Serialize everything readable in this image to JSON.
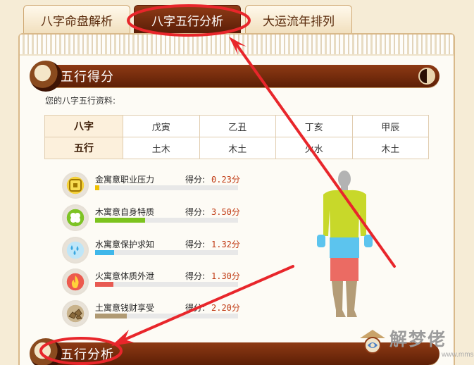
{
  "tabs": [
    {
      "label": "八字命盘解析",
      "active": false
    },
    {
      "label": "八字五行分析",
      "active": true
    },
    {
      "label": "大运流年排列",
      "active": false
    }
  ],
  "sections": {
    "scores_title": "五行得分",
    "analysis_title": "五行分析"
  },
  "intro": "您的八字五行资料:",
  "table": {
    "rows": [
      {
        "head": "八字",
        "cells": [
          "戊寅",
          "乙丑",
          "丁亥",
          "甲辰"
        ]
      },
      {
        "head": "五行",
        "cells": [
          "土木",
          "木土",
          "火水",
          "木土"
        ]
      }
    ]
  },
  "scores": [
    {
      "element": "metal",
      "icon": "coin-icon",
      "label": "金寓意职业压力",
      "score_label": "得分:",
      "score": "0.23分",
      "value": 0.23,
      "color": "#f0c000"
    },
    {
      "element": "wood",
      "icon": "clover-icon",
      "label": "木寓意自身特质",
      "score_label": "得分:",
      "score": "3.50分",
      "value": 3.5,
      "color": "#7cc31e"
    },
    {
      "element": "water",
      "icon": "water-drops-icon",
      "label": "水寓意保护求知",
      "score_label": "得分:",
      "score": "1.32分",
      "value": 1.32,
      "color": "#3fb7ea"
    },
    {
      "element": "fire",
      "icon": "flame-icon",
      "label": "火寓意体质外泄",
      "score_label": "得分:",
      "score": "1.30分",
      "value": 1.3,
      "color": "#e85a52"
    },
    {
      "element": "earth",
      "icon": "rocks-icon",
      "label": "土寓意钱财享受",
      "score_label": "得分:",
      "score": "2.20分",
      "value": 2.2,
      "color": "#b09a73"
    }
  ],
  "score_max": 10,
  "figure_colors": {
    "head": "#b3b3b3",
    "torso": "#c8d82a",
    "hands": "#5cc4ee",
    "shorts": "#5cc4ee",
    "thighs": "#eb6b63",
    "legs": "#b49c77"
  },
  "watermark": {
    "text": "解梦佬",
    "url": "www.mmsg.com"
  },
  "annotation_color": "#e8262b"
}
